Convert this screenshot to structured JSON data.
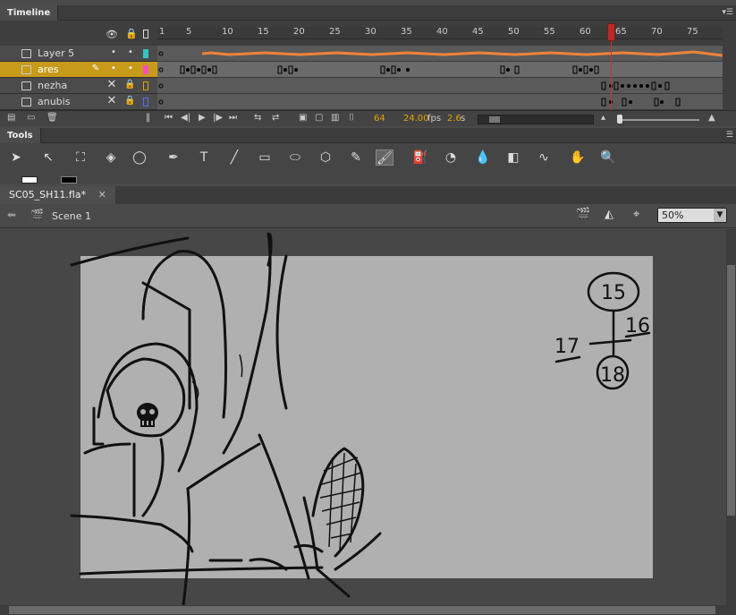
{
  "timeline": {
    "title": "Timeline",
    "ruler": [
      "1",
      "5",
      "10",
      "15",
      "20",
      "25",
      "30",
      "35",
      "40",
      "45",
      "50",
      "55",
      "60",
      "65",
      "70",
      "75"
    ],
    "layers": [
      {
        "name": "Layer 5",
        "color": "#35c3c3"
      },
      {
        "name": "ares",
        "color": "#ff4fb8"
      },
      {
        "name": "nezha",
        "color": "#e3a300"
      },
      {
        "name": "anubis",
        "color": "#5b6cff"
      }
    ],
    "footer": {
      "frame": "64",
      "fps": "24.00",
      "fps_unit": "fps",
      "time": "2.6",
      "time_unit": "s"
    }
  },
  "tools": {
    "title": "Tools"
  },
  "document": {
    "tab": "SC05_SH11.fla*",
    "scene": "Scene 1",
    "zoom": "50%"
  },
  "sketch": {
    "top": "15",
    "right": "16",
    "left": "17",
    "bottom": "18"
  },
  "colors": {
    "selected_layer": "#c79a1a",
    "playhead": "#b82929",
    "canvas": "#b0b0b0"
  }
}
